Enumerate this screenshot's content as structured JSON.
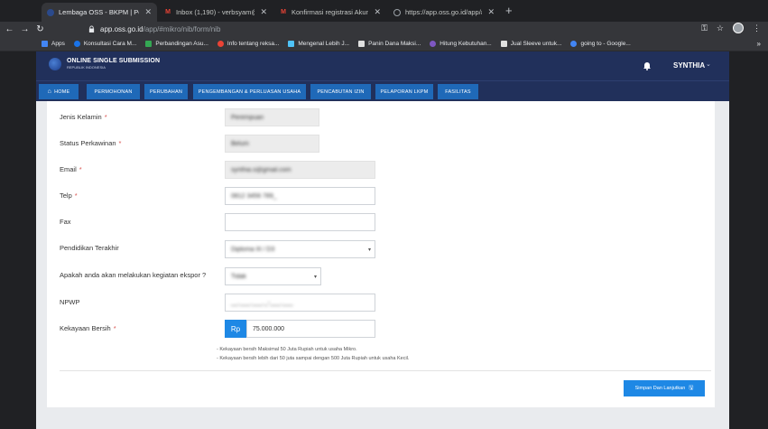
{
  "browser": {
    "tabs": [
      {
        "label": "Lembaga OSS - BKPM | Pelay",
        "icon": "oss-favicon",
        "active": true
      },
      {
        "label": "Inbox (1,190) - verbsyam@gm",
        "icon": "gmail-icon"
      },
      {
        "label": "Konfirmasi registrasi Akun Sis",
        "icon": "gmail-icon"
      },
      {
        "label": "https://app.oss.go.id/app/#ro/",
        "icon": "globe-icon"
      }
    ],
    "url_host": "app.oss.go.id",
    "url_path": "/app/#mikro/nib/form/nib",
    "bookmarks": [
      {
        "label": "Apps",
        "color": "#4285f4"
      },
      {
        "label": "Konsultasi Cara M...",
        "color": "#1a73e8"
      },
      {
        "label": "Perbandingan Asu...",
        "color": "#34a853"
      },
      {
        "label": "Info tentang reksa...",
        "color": "#ea4335"
      },
      {
        "label": "Mengenal Lebih J...",
        "color": "#4fc3f7"
      },
      {
        "label": "Panin Dana Maksi...",
        "color": "#e0e0e0"
      },
      {
        "label": "Hitung Kebutuhan...",
        "color": "#7e57c2"
      },
      {
        "label": "Jual Sleeve untuk...",
        "color": "#e0e0e0"
      },
      {
        "label": "going to - Google...",
        "color": "#4285f4"
      }
    ]
  },
  "header": {
    "logo_title": "ONLINE SINGLE SUBMISSION",
    "logo_sub": "REPUBLIK INDONESIA",
    "user": "SYNTHIA"
  },
  "nav": [
    {
      "label": "HOME"
    },
    {
      "label": "PERMOHONAN"
    },
    {
      "label": "PERUBAHAN"
    },
    {
      "label": "PENGEMBANGAN & PERLUASAN USAHA"
    },
    {
      "label": "PENCABUTAN IZIN"
    },
    {
      "label": "PELAPORAN LKPM"
    },
    {
      "label": "FASILITAS"
    }
  ],
  "form": {
    "jenis_kelamin": {
      "label": "Jenis Kelamin",
      "value": "Perempuan"
    },
    "status_perkawinan": {
      "label": "Status Perkawinan",
      "value": "Belum"
    },
    "email": {
      "label": "Email",
      "value": "synthia.s@gmail.com"
    },
    "telp": {
      "label": "Telp",
      "value": "0812 3456 789_"
    },
    "fax": {
      "label": "Fax",
      "value": ""
    },
    "pendidikan": {
      "label": "Pendidikan Terakhir",
      "value": "Diploma III / D3"
    },
    "ekspor": {
      "label": "Apakah anda akan melakukan kegiatan ekspor ?",
      "value": "Tidak"
    },
    "npwp": {
      "label": "NPWP",
      "value": "__.___.___._-___.___"
    },
    "kekayaan": {
      "label": "Kekayaan Bersih",
      "prefix": "Rp",
      "value": "75.000.000"
    },
    "notes": [
      "- Kekayaan bersih Maksimal 50 Juta Rupiah untuk usaha Mikro.",
      "- Kekayaan bersih lebih dari 50 juta sampai dengan 500 Juta Rupiah untuk usaha Kecil."
    ],
    "required_mark": "*",
    "save_label": "Simpan Dan Lanjutkan"
  },
  "colors": {
    "header_bg": "#21305b",
    "nav_button": "#1f69b8",
    "primary": "#1e88e5",
    "required": "#d9534f"
  }
}
